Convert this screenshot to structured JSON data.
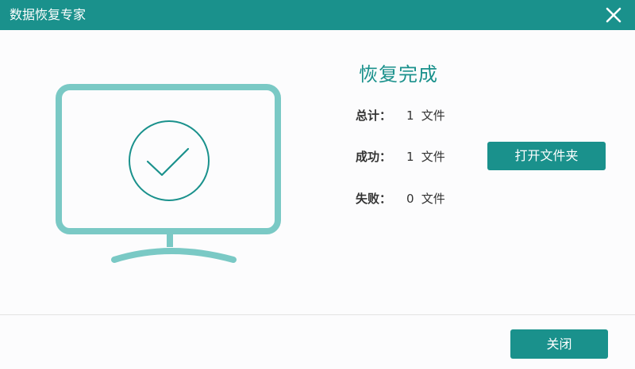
{
  "window": {
    "title": "数据恢复专家"
  },
  "icons": {
    "close": "close-icon",
    "illustration": "monitor-checkmark-icon"
  },
  "colors": {
    "accent": "#1a918c",
    "illustration": "#7ac9c5"
  },
  "result": {
    "heading": "恢复完成",
    "rows": [
      {
        "label": "总计：",
        "count": "1",
        "unit": "文件"
      },
      {
        "label": "成功：",
        "count": "1",
        "unit": "文件"
      },
      {
        "label": "失败：",
        "count": "0",
        "unit": "文件"
      }
    ],
    "open_folder_label": "打开文件夹"
  },
  "footer": {
    "close_label": "关闭"
  }
}
